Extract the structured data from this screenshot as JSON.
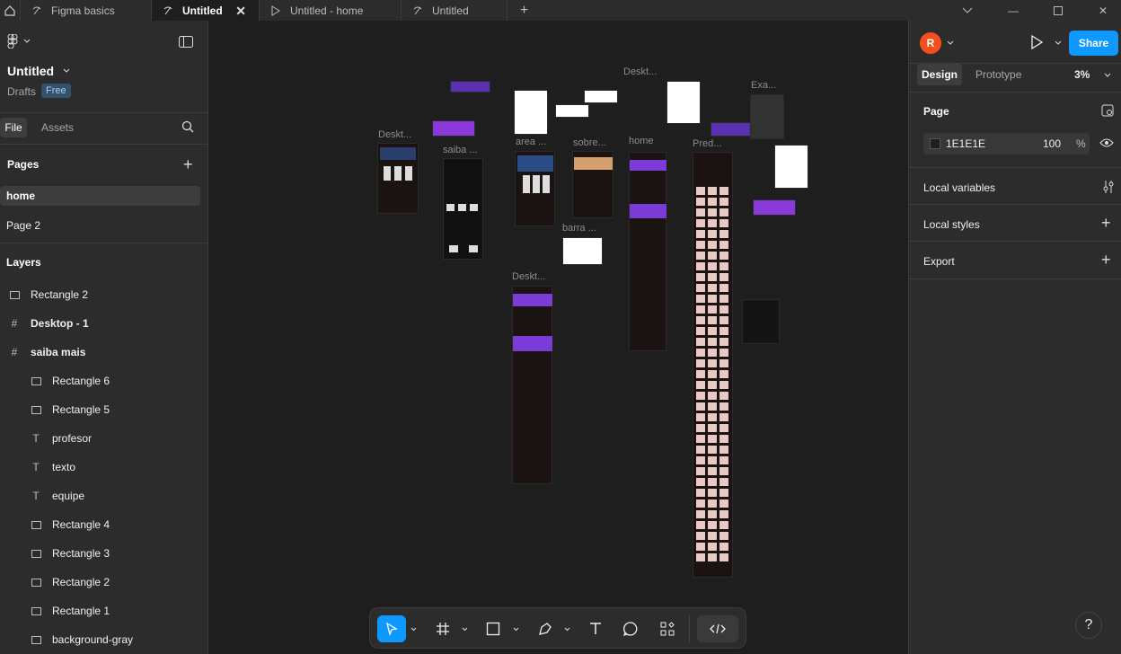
{
  "tabs": [
    {
      "label": "Figma basics",
      "icon": "figma-file-icon",
      "active": false
    },
    {
      "label": "Untitled",
      "icon": "figma-file-icon",
      "active": true
    },
    {
      "label": "Untitled - home",
      "icon": "play-icon",
      "active": false
    },
    {
      "label": "Untitled",
      "icon": "figma-file-icon",
      "active": false
    }
  ],
  "file": {
    "title": "Untitled",
    "location": "Drafts",
    "plan_badge": "Free"
  },
  "left_tabs": {
    "file": "File",
    "assets": "Assets"
  },
  "pages": {
    "header": "Pages",
    "items": [
      "home",
      "Page 2"
    ],
    "selected": "home"
  },
  "layers": {
    "header": "Layers",
    "items": [
      {
        "label": "Rectangle 2",
        "icon": "rectangle-icon",
        "indent": 0,
        "bold": false
      },
      {
        "label": "Desktop - 1",
        "icon": "frame-icon",
        "indent": 0,
        "bold": true
      },
      {
        "label": "saiba mais",
        "icon": "frame-icon",
        "indent": 0,
        "bold": true
      },
      {
        "label": "Rectangle 6",
        "icon": "rectangle-icon",
        "indent": 1,
        "bold": false
      },
      {
        "label": "Rectangle 5",
        "icon": "rectangle-icon",
        "indent": 1,
        "bold": false
      },
      {
        "label": "profesor",
        "icon": "text-icon",
        "indent": 1,
        "bold": false
      },
      {
        "label": "texto",
        "icon": "text-icon",
        "indent": 1,
        "bold": false
      },
      {
        "label": "equipe",
        "icon": "text-icon",
        "indent": 1,
        "bold": false
      },
      {
        "label": "Rectangle 4",
        "icon": "rectangle-icon",
        "indent": 1,
        "bold": false
      },
      {
        "label": "Rectangle 3",
        "icon": "rectangle-icon",
        "indent": 1,
        "bold": false
      },
      {
        "label": "Rectangle 2",
        "icon": "rectangle-icon",
        "indent": 1,
        "bold": false
      },
      {
        "label": "Rectangle 1",
        "icon": "rectangle-icon",
        "indent": 1,
        "bold": false
      },
      {
        "label": "background-gray",
        "icon": "rectangle-icon",
        "indent": 1,
        "bold": false
      }
    ]
  },
  "right_panel": {
    "avatar_letter": "R",
    "share_label": "Share",
    "design_tab": "Design",
    "prototype_tab": "Prototype",
    "zoom": "3%",
    "page_section": "Page",
    "page_color_hex": "1E1E1E",
    "page_opacity": "100",
    "percent_sign": "%",
    "local_variables": "Local variables",
    "local_styles": "Local styles",
    "export": "Export"
  },
  "canvas_labels": [
    "Deskt...",
    "saiba ...",
    "area ...",
    "sobre...",
    "Deskt...",
    "home",
    "Pred...",
    "Exa...",
    "barra ...",
    "Deskt..."
  ],
  "toolbar_tools": [
    "move-tool-icon",
    "frame-tool-icon",
    "rectangle-tool-icon",
    "pen-tool-icon",
    "text-tool-icon",
    "comment-tool-icon",
    "actions-tool-icon",
    "dev-mode-icon"
  ],
  "help_label": "?",
  "colors": {
    "accent": "#0d99ff",
    "avatar": "#f24e1e",
    "panel": "#2c2c2c",
    "canvas": "#1e1e1e"
  }
}
